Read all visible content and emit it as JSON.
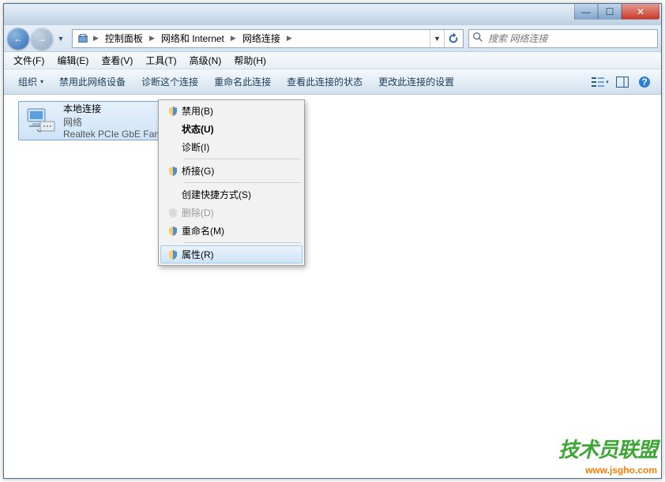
{
  "titlebar": {
    "min": "—",
    "max": "☐",
    "close": "✕"
  },
  "nav": {
    "back": "←",
    "fwd": "→"
  },
  "address": {
    "parts": [
      "控制面板",
      "网络和 Internet",
      "网络连接"
    ]
  },
  "search": {
    "placeholder": "搜索 网络连接"
  },
  "menubar": {
    "items": [
      "文件(F)",
      "编辑(E)",
      "查看(V)",
      "工具(T)",
      "高级(N)",
      "帮助(H)"
    ]
  },
  "toolbar": {
    "organize": "组织",
    "disable": "禁用此网络设备",
    "diagnose": "诊断这个连接",
    "rename": "重命名此连接",
    "status": "查看此连接的状态",
    "change": "更改此连接的设置"
  },
  "netitem": {
    "title": "本地连接",
    "sub1": "网络",
    "sub2": "Realtek PCIe GbE Family Controller"
  },
  "ctx": {
    "disable": "禁用(B)",
    "status": "状态(U)",
    "diagnose": "诊断(I)",
    "bridge": "桥接(G)",
    "shortcut": "创建快捷方式(S)",
    "delete": "删除(D)",
    "rename": "重命名(M)",
    "properties": "属性(R)"
  },
  "watermark": {
    "line1": "技术员联盟",
    "line2_a": "www",
    "line2_b": "jsgho",
    "line2_c": "com"
  }
}
